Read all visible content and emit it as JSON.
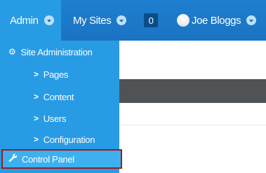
{
  "topbar": {
    "admin_label": "Admin",
    "mysites_label": "My Sites",
    "notification_count": "0",
    "user_name": "Joe Bloggs"
  },
  "dropdown": {
    "header_label": "Site Administration",
    "items": [
      {
        "label": "Pages"
      },
      {
        "label": "Content"
      },
      {
        "label": "Users"
      },
      {
        "label": "Configuration"
      }
    ],
    "control_panel_label": "Control Panel"
  },
  "icons": {
    "admin_caret": "chevron-down-icon",
    "header_icon": "gear-icon",
    "sub_item_icon": "chevron-right-icon",
    "control_panel_icon": "wrench-icon"
  },
  "colors": {
    "topbar": "#1a73c2",
    "dropdown": "#289be5",
    "highlight_border": "#9a1c22",
    "badge": "#0a4d86"
  }
}
